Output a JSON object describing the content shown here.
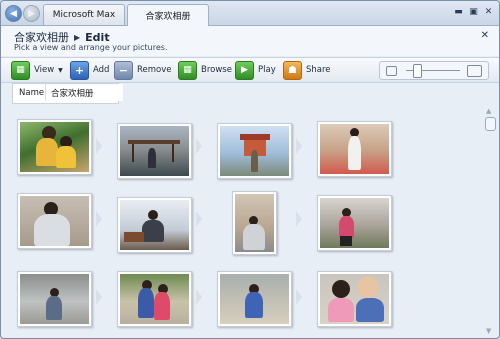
{
  "tabs": [
    {
      "label": "Microsoft Max"
    },
    {
      "label": "合家欢相册"
    }
  ],
  "window_controls": {
    "minimize": "▬",
    "maximize": "▣",
    "close": "✕"
  },
  "header": {
    "album_name": "合家欢相册",
    "separator": "▶",
    "page": "Edit",
    "subtitle": "Pick a view and arrange your pictures.",
    "close": "✕"
  },
  "toolbar": {
    "view_label": "View",
    "add_label": "Add",
    "remove_label": "Remove",
    "browse_label": "Browse",
    "play_label": "Play",
    "share_label": "Share",
    "zoom_level": 0.2
  },
  "name_field": {
    "label": "Name",
    "value": "合家欢相册"
  },
  "photos": [
    {
      "subject": "children playing"
    },
    {
      "subject": "pavilion"
    },
    {
      "subject": "pagoda"
    },
    {
      "subject": "man in courtyard"
    },
    {
      "subject": "man seated"
    },
    {
      "subject": "man at desk"
    },
    {
      "subject": "man outdoors"
    },
    {
      "subject": "woman in courtyard"
    },
    {
      "subject": "child walking"
    },
    {
      "subject": "two children"
    },
    {
      "subject": "child on sidewalk"
    },
    {
      "subject": "children close-up"
    }
  ],
  "colors": {
    "accent": "#2b62b4",
    "window_bg": "#e8eef6",
    "titlebar": "#c9d6e6"
  }
}
